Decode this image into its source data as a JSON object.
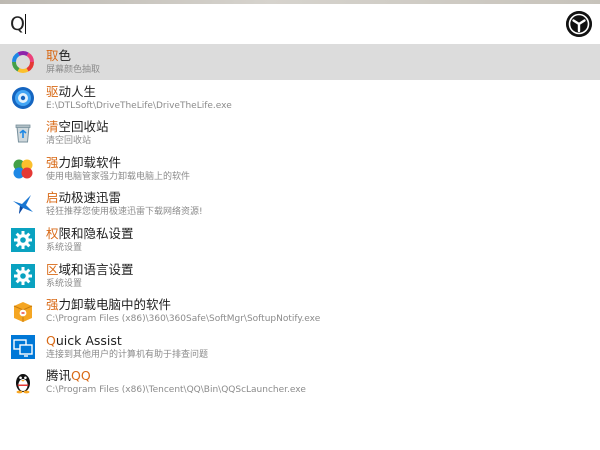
{
  "search": {
    "query": "Q"
  },
  "colors": {
    "highlight": "#d86a17",
    "selected_row": "#dcdcdc",
    "subtitle": "#8b8b8b"
  },
  "results": [
    {
      "icon": "color-wheel-icon",
      "title_hl": "取",
      "title_rest": "色",
      "title_pre": "",
      "subtitle": "屏幕颜色抽取"
    },
    {
      "icon": "gear-disc-icon",
      "title_hl": "驱",
      "title_rest": "动人生",
      "title_pre": "",
      "subtitle": "E:\\DTLSoft\\DriveTheLife\\DriveTheLife.exe"
    },
    {
      "icon": "recycle-bin-icon",
      "title_hl": "清",
      "title_rest": "空回收站",
      "title_pre": "",
      "subtitle": "清空回收站"
    },
    {
      "icon": "clover-icon",
      "title_hl": "强",
      "title_rest": "力卸载软件",
      "title_pre": "",
      "subtitle": "使用电脑管家强力卸载电脑上的软件"
    },
    {
      "icon": "bird-icon",
      "title_hl": "启",
      "title_rest": "动极速迅雷",
      "title_pre": "",
      "subtitle": "轻狂推荐您使用极速迅雷下载网络资源!"
    },
    {
      "icon": "settings-gear-icon",
      "title_hl": "权",
      "title_rest": "限和隐私设置",
      "title_pre": "",
      "subtitle": "系统设置"
    },
    {
      "icon": "settings-gear-icon",
      "title_hl": "区",
      "title_rest": "域和语言设置",
      "title_pre": "",
      "subtitle": "系统设置"
    },
    {
      "icon": "software-box-icon",
      "title_hl": "强",
      "title_rest": "力卸载电脑中的软件",
      "title_pre": "",
      "subtitle": "C:\\Program Files (x86)\\360\\360Safe\\SoftMgr\\SoftupNotify.exe"
    },
    {
      "icon": "remote-monitor-icon",
      "title_hl": "Q",
      "title_rest": "uick Assist",
      "title_pre": "",
      "subtitle": "连接到其他用户的计算机有助于排查问题"
    },
    {
      "icon": "penguin-icon",
      "title_hl": "QQ",
      "title_rest": "",
      "title_pre": "腾讯",
      "subtitle": "C:\\Program Files (x86)\\Tencent\\QQ\\Bin\\QQScLauncher.exe"
    }
  ]
}
